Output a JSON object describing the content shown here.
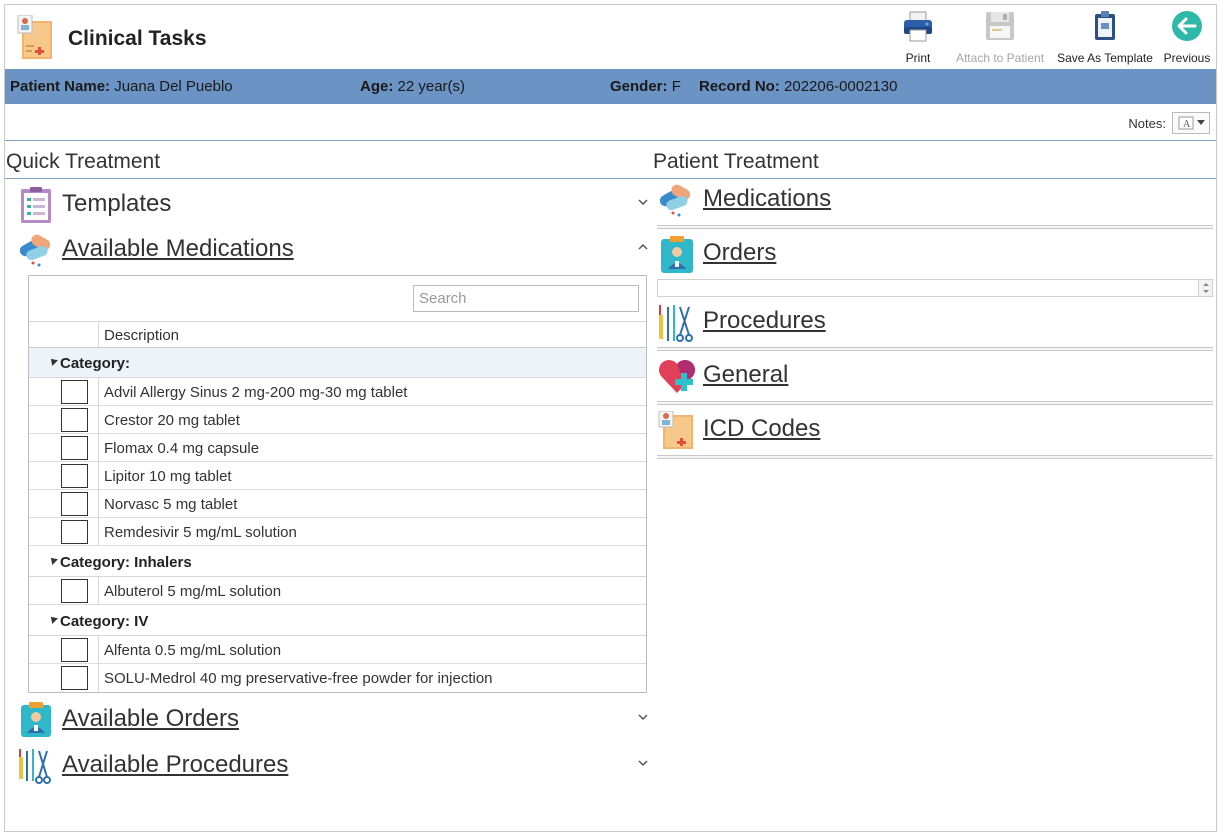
{
  "header": {
    "title": "Clinical Tasks",
    "toolbar": [
      {
        "label": "Print",
        "icon": "printer-icon",
        "enabled": true
      },
      {
        "label": "Attach to Patient",
        "icon": "save-disk-icon",
        "enabled": false
      },
      {
        "label": "Save As Template",
        "icon": "clipboard-icon",
        "enabled": true
      },
      {
        "label": "Previous",
        "icon": "back-arrow-icon",
        "enabled": true
      }
    ]
  },
  "patient": {
    "name_label": "Patient Name:",
    "name": "Juana Del Pueblo",
    "age_label": "Age:",
    "age": "22 year(s)",
    "gender_label": "Gender:",
    "gender": "F",
    "record_label": "Record No:",
    "record": "202206-0002130"
  },
  "notes": {
    "label": "Notes:"
  },
  "quick_treatment": {
    "title": "Quick Treatment",
    "templates_label": "Templates",
    "available_medications_label": "Available Medications",
    "available_orders_label": "Available Orders",
    "available_procedures_label": "Available Procedures",
    "search_placeholder": "Search",
    "column_description": "Description",
    "categories": [
      {
        "label": "Category:",
        "items": [
          "Advil Allergy Sinus 2 mg-200 mg-30 mg tablet",
          "Crestor 20 mg tablet",
          "Flomax 0.4 mg capsule",
          "Lipitor 10 mg tablet",
          "Norvasc 5 mg tablet",
          "Remdesivir 5 mg/mL solution"
        ]
      },
      {
        "label": "Category: Inhalers",
        "items": [
          "Albuterol 5 mg/mL solution"
        ]
      },
      {
        "label": "Category: IV",
        "items": [
          "Alfenta 0.5 mg/mL solution",
          "SOLU-Medrol 40 mg preservative-free powder for injection"
        ]
      }
    ]
  },
  "patient_treatment": {
    "title": "Patient Treatment",
    "medications_label": "Medications",
    "orders_label": "Orders",
    "procedures_label": "Procedures",
    "general_label": "General",
    "icd_label": "ICD Codes"
  },
  "colors": {
    "patient_bar": "#6b93c4",
    "accent": "#2eb8c4",
    "rule": "#7fa1c6"
  }
}
